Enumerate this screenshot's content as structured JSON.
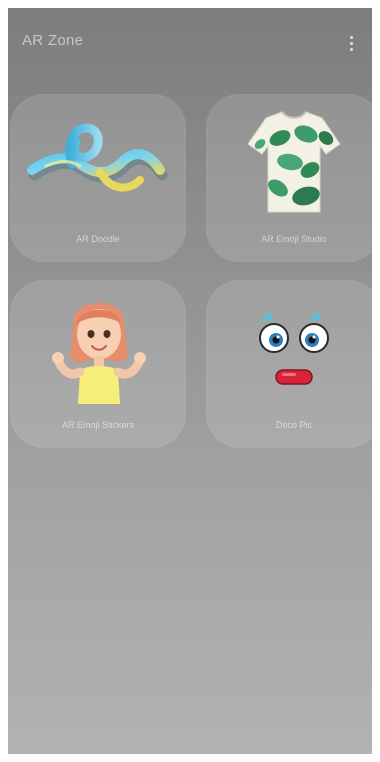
{
  "header": {
    "title": "AR Zone",
    "more_icon": "more-vertical-icon"
  },
  "tiles": [
    {
      "label": "AR Doodle",
      "icon": "doodle-art"
    },
    {
      "label": "AR Emoji Studio",
      "icon": "shirt-art"
    },
    {
      "label": "AR Emoji Stickers",
      "icon": "emoji-avatar-art"
    },
    {
      "label": "Deco Pic",
      "icon": "cartoon-face-art"
    }
  ],
  "colors": {
    "background_top": "#7d7d7d",
    "background_bottom": "#b2b2b2",
    "tile_fill": "rgba(255,255,255,0.13)"
  }
}
